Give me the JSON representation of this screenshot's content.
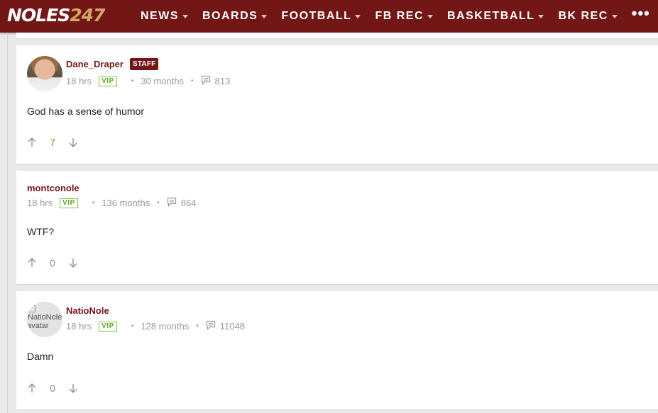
{
  "brand": {
    "logo_white": "NOLES",
    "logo_gold": "247"
  },
  "nav": {
    "items": [
      {
        "label": "NEWS"
      },
      {
        "label": "BOARDS"
      },
      {
        "label": "FOOTBALL"
      },
      {
        "label": "FB REC"
      },
      {
        "label": "BASKETBALL"
      },
      {
        "label": "BK REC"
      }
    ],
    "more": "•••"
  },
  "posts": [
    {
      "username": "Dane_Draper",
      "badge": "STAFF",
      "time": "18 hrs",
      "vip": "VIP",
      "tenure": "30 months",
      "post_count": "813",
      "body": "God has a sense of humor",
      "score": "7"
    },
    {
      "username": "montconole",
      "time": "18 hrs",
      "vip": "VIP",
      "tenure": "136 months",
      "post_count": "864",
      "body": "WTF?",
      "score": "0"
    },
    {
      "username": "NatioNole",
      "avatar_alt": "NatioNole avatar",
      "time": "18 hrs",
      "vip": "VIP",
      "tenure": "128 months",
      "post_count": "11048",
      "body": "Damn",
      "score": "0"
    }
  ],
  "colors": {
    "brand": "#731616",
    "gold": "#cfa966",
    "vip": "#5aa82a"
  }
}
